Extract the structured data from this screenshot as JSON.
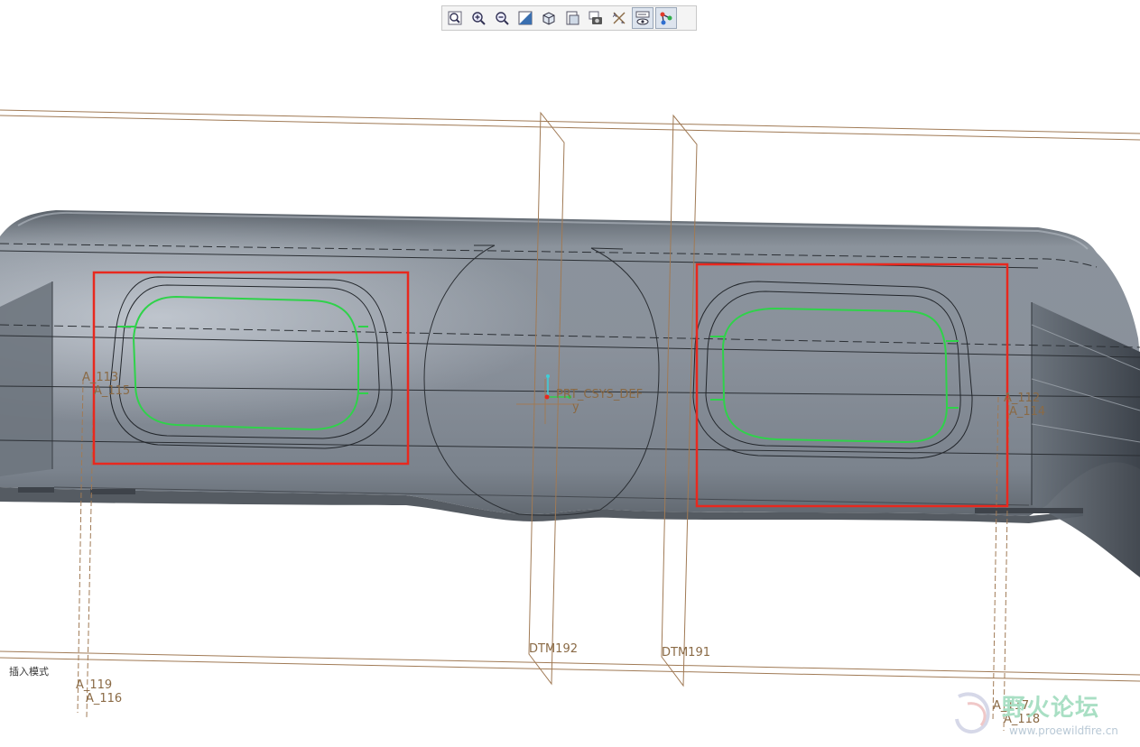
{
  "toolbar": {
    "items": [
      {
        "name": "refit",
        "icon": "zoom-fit-icon",
        "active": false
      },
      {
        "name": "zoom-in",
        "icon": "zoom-in-icon",
        "active": false
      },
      {
        "name": "zoom-out",
        "icon": "zoom-out-icon",
        "active": false
      },
      {
        "name": "repaint",
        "icon": "repaint-icon",
        "active": false
      },
      {
        "name": "display-style",
        "icon": "cube-icon",
        "active": false
      },
      {
        "name": "saved-views",
        "icon": "saved-views-icon",
        "active": false
      },
      {
        "name": "view-manager",
        "icon": "camera-icon",
        "active": false
      },
      {
        "name": "datum-display",
        "icon": "datum-display-icon",
        "active": false
      },
      {
        "name": "annotation-display",
        "icon": "annotation-display-icon",
        "active": true
      },
      {
        "name": "spin-center",
        "icon": "spin-center-icon",
        "active": true
      }
    ]
  },
  "datum_labels": {
    "a113": "A_113",
    "a115": "A_115",
    "a114": "A_114",
    "a112": "A_112",
    "csys": "PRT_CSYS_DEF",
    "csys_y": "y",
    "dtm192": "DTM192",
    "dtm191": "DTM191",
    "a119": "A_119",
    "a116": "A_116",
    "a117": "A_117",
    "a118": "A_118"
  },
  "status": {
    "mode": "插入模式"
  },
  "watermark": {
    "title": "野火论坛",
    "url": "www.proewildfire.cn"
  },
  "colors": {
    "part": "#7d848d",
    "selection": "#e8281e",
    "highlight": "#2fd24a",
    "datum": "#9a7150"
  }
}
